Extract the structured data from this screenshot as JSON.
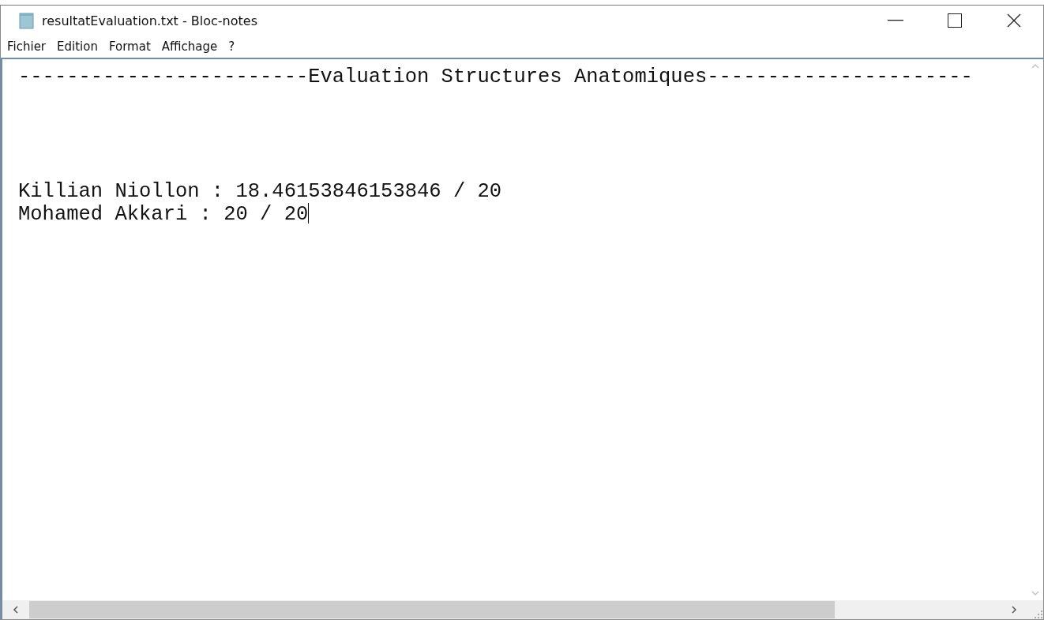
{
  "window": {
    "title": "resultatEvaluation.txt - Bloc-notes"
  },
  "menu": [
    "Fichier",
    "Edition",
    "Format",
    "Affichage",
    "?"
  ],
  "editor": {
    "text": "------------------------Evaluation Structures Anatomiques----------------------\n\n\n\n\nKillian Niollon : 18.46153846153846 / 20\nMohamed Akkari : 20 / 20",
    "cursor_visible": true
  }
}
